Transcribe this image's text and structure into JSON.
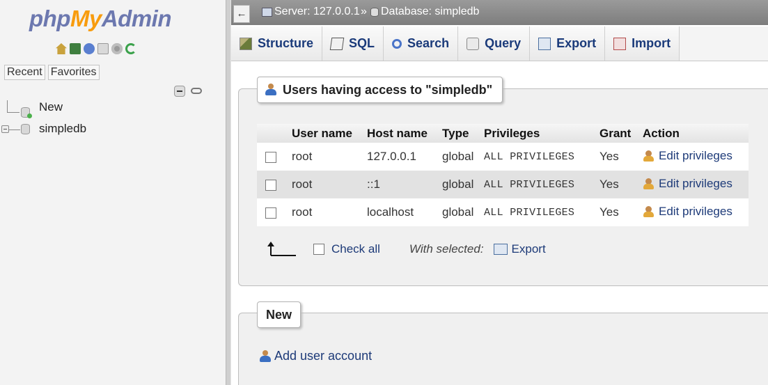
{
  "nav": {
    "logo": {
      "part1": "php",
      "part2": "My",
      "part3": "Admin"
    },
    "icons": [
      "home-icon",
      "exit-icon",
      "help-icon",
      "docs-icon",
      "settings-icon",
      "reload-icon"
    ],
    "tabs": [
      "Recent",
      "Favorites"
    ],
    "tree": [
      {
        "label": "New"
      },
      {
        "label": "simpledb"
      }
    ]
  },
  "breadcrumb": {
    "back": "←",
    "server": "Server: 127.0.0.1",
    "separator": "»",
    "database": "Database: simpledb"
  },
  "tabs": [
    {
      "label": "Structure",
      "icon": "structure-icon"
    },
    {
      "label": "SQL",
      "icon": "sql-icon"
    },
    {
      "label": "Search",
      "icon": "search-icon"
    },
    {
      "label": "Query",
      "icon": "query-icon"
    },
    {
      "label": "Export",
      "icon": "export-icon"
    },
    {
      "label": "Import",
      "icon": "import-icon"
    }
  ],
  "users_section": {
    "legend": "Users having access to \"simpledb\"",
    "columns": [
      "User name",
      "Host name",
      "Type",
      "Privileges",
      "Grant",
      "Action"
    ],
    "rows": [
      {
        "user": "root",
        "host": "127.0.0.1",
        "type": "global",
        "privileges": "ALL PRIVILEGES",
        "grant": "Yes",
        "action": "Edit privileges"
      },
      {
        "user": "root",
        "host": "::1",
        "type": "global",
        "privileges": "ALL PRIVILEGES",
        "grant": "Yes",
        "action": "Edit privileges"
      },
      {
        "user": "root",
        "host": "localhost",
        "type": "global",
        "privileges": "ALL PRIVILEGES",
        "grant": "Yes",
        "action": "Edit privileges"
      }
    ],
    "check_all": "Check all",
    "with_selected": "With selected:",
    "export": "Export"
  },
  "new_section": {
    "legend": "New",
    "add_user": "Add user account"
  },
  "colors": {
    "logo_blue": "#6c78af",
    "logo_orange": "#f89c0e",
    "link": "#1d3a78",
    "row_alt": "#e2e2e2"
  }
}
